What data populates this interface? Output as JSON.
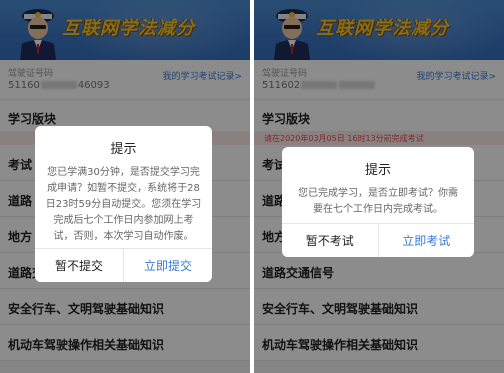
{
  "panels": [
    {
      "banner_title": "互联网学法减分",
      "license_label": "驾驶证号码",
      "license_prefix": "51160",
      "license_suffix": "46093",
      "record_link": "我的学习考试记录>",
      "section_title": "学习版块",
      "notice": "",
      "list_items": [
        "考试",
        "道路",
        "地方",
        "道路交通信号",
        "安全行车、文明驾驶基础知识",
        "机动车驾驶操作相关基础知识"
      ],
      "dialog": {
        "title": "提示",
        "message": "您已学满30分钟，是否提交学习完成申请？如暂不提交，系统将于28日23时59分自动提交。您须在学习完成后七个工作日内参加网上考试，否则，本次学习自动作废。",
        "secondary_label": "暂不提交",
        "primary_label": "立即提交"
      }
    },
    {
      "banner_title": "互联网学法减分",
      "license_label": "驾驶证号码",
      "license_prefix": "511602",
      "license_suffix": "",
      "record_link": "我的学习考试记录>",
      "section_title": "学习版块",
      "notice": "请在2020年03月05日 16时13分前完成考试",
      "list_items": [
        "考试",
        "道路",
        "地方",
        "道路交通信号",
        "安全行车、文明驾驶基础知识",
        "机动车驾驶操作相关基础知识"
      ],
      "dialog": {
        "title": "提示",
        "message": "您已完成学习，是否立即考试？你需要在七个工作日内完成考试。",
        "secondary_label": "暂不考试",
        "primary_label": "立即考试"
      }
    }
  ],
  "colors": {
    "banner": "#3a76c4",
    "banner_title": "#f7c830",
    "link": "#3a7bd5",
    "notice_bg": "#fde9e9",
    "notice_text": "#e05050"
  }
}
